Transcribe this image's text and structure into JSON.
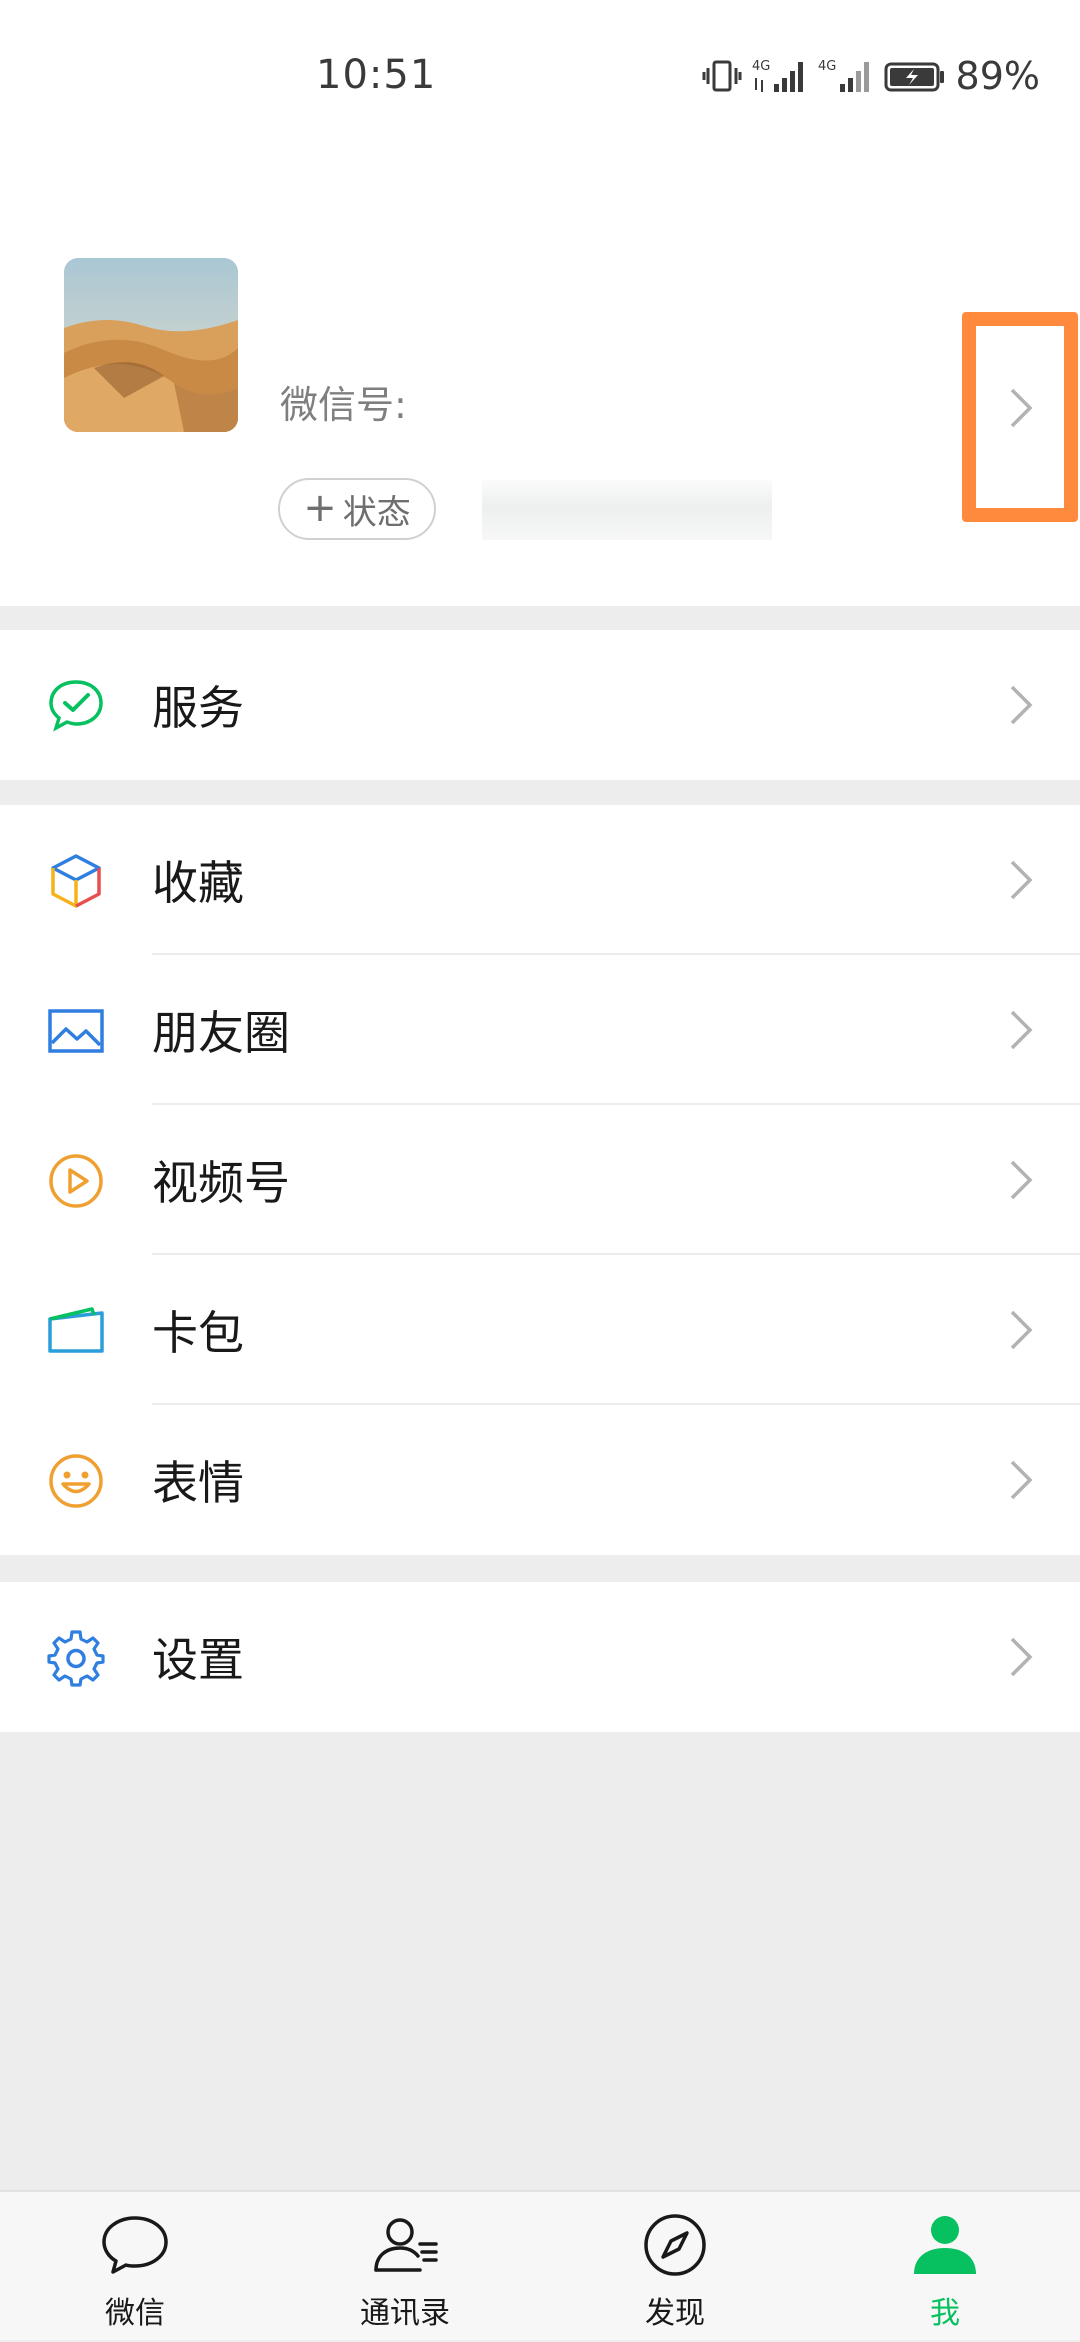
{
  "status_bar": {
    "time": "10:51",
    "battery": "89%",
    "network_1": "4G",
    "network_2": "4G"
  },
  "profile": {
    "wechat_id_label": "微信号:",
    "status_button": "状态",
    "status_plus": "+"
  },
  "menu": {
    "services": "服务",
    "favorites": "收藏",
    "moments": "朋友圈",
    "channels": "视频号",
    "cards": "卡包",
    "stickers": "表情",
    "settings": "设置"
  },
  "tabs": {
    "chats": "微信",
    "contacts": "通讯录",
    "discover": "发现",
    "me": "我"
  },
  "colors": {
    "accent": "#07c160",
    "highlight": "#ff8a3d",
    "background": "#ededed"
  }
}
